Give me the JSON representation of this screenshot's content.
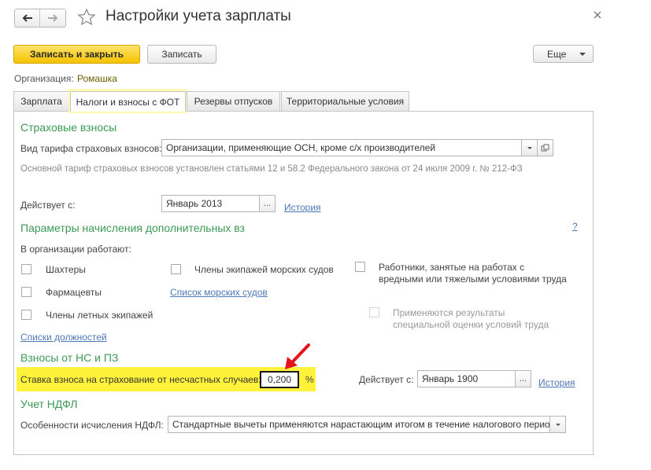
{
  "window": {
    "title": "Настройки учета зарплаты"
  },
  "toolbar": {
    "save_close_label": "Записать и закрыть",
    "save_label": "Записать",
    "more_label": "Еще"
  },
  "organization": {
    "label": "Организация:",
    "value": "Ромашка"
  },
  "tabs": [
    {
      "label": "Зарплата"
    },
    {
      "label": "Налоги и взносы с ФОТ"
    },
    {
      "label": "Резервы отпусков"
    },
    {
      "label": "Территориальные условия"
    }
  ],
  "insurance": {
    "title": "Страховые взносы",
    "tariff_label": "Вид тарифа страховых взносов:",
    "tariff_value": "Организации, применяющие ОСН, кроме с/х производителей",
    "note": "Основной тариф страховых взносов установлен статьями 12 и 58.2 Федерального закона от 24 июля 2009 г. № 212-ФЗ",
    "effective_label": "Действует с:",
    "effective_value": "Январь 2013",
    "history_link": "История"
  },
  "additional": {
    "title": "Параметры начисления дополнительных вз",
    "help": "?",
    "works_label": "В организации работают:",
    "checkboxes": [
      {
        "label": "Шахтеры"
      },
      {
        "label": "Фармацевты"
      },
      {
        "label": "Члены летных экипажей"
      },
      {
        "label": "Члены экипажей морских судов"
      },
      {
        "label": "Работники, занятые на работах с",
        "label2": "вредными или тяжелыми условиями труда"
      },
      {
        "label": "Применяются результаты",
        "label2": "специальной оценки условий труда"
      }
    ],
    "ships_link": "Список морских судов",
    "positions_link": "Списки должностей"
  },
  "ns": {
    "title": "Взносы от НС и ПЗ",
    "rate_label": "Ставка взноса на страхование от несчастных случаев:",
    "rate_value": "0,200",
    "rate_unit": "%",
    "effective_label": "Действует с:",
    "effective_value": "Январь 1900",
    "history_link": "История"
  },
  "ndfl": {
    "title": "Учет НДФЛ",
    "calc_label": "Особенности исчисления НДФЛ:",
    "calc_value": "Стандартные вычеты применяются нарастающим итогом в течение налогового периода"
  },
  "colors": {
    "accent_yellow": "#f6c200",
    "highlight_yellow": "#fff23a",
    "section_green": "#3b9a56",
    "link_blue": "#4c79b8",
    "arrow_red": "#e3141c"
  }
}
